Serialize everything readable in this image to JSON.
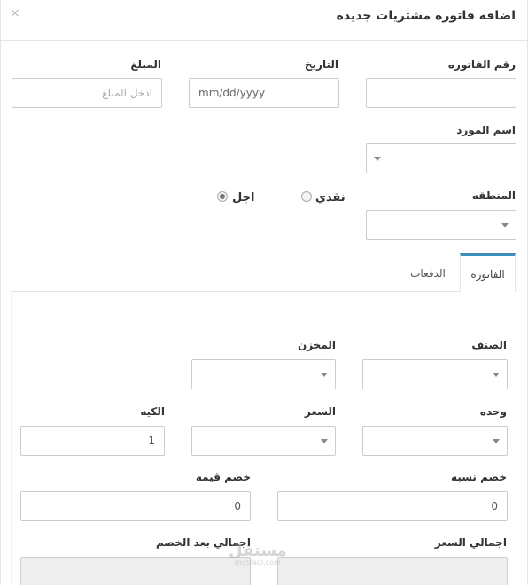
{
  "modal": {
    "title": "اضافه فاتوره مشتريات جديده",
    "close_glyph": "×"
  },
  "form": {
    "invoice_number": {
      "label": "رقم الفاتوره",
      "value": ""
    },
    "date": {
      "label": "التاريخ",
      "placeholder": "mm/dd/yyyy"
    },
    "amount": {
      "label": "المبلغ",
      "placeholder": "ادخل المبلغ"
    },
    "supplier": {
      "label": "اسم المورد",
      "value": ""
    },
    "region": {
      "label": "المنطقه",
      "value": ""
    },
    "payment_type": {
      "options": [
        {
          "label": "نقدي",
          "checked": false
        },
        {
          "label": "اجل",
          "checked": true
        }
      ]
    }
  },
  "tabs": [
    {
      "label": "الفاتوره",
      "active": true
    },
    {
      "label": "الدفعات",
      "active": false
    }
  ],
  "invoice_tab": {
    "item": {
      "label": "الصنف"
    },
    "warehouse": {
      "label": "المخزن"
    },
    "unit": {
      "label": "وحده"
    },
    "price": {
      "label": "السعر"
    },
    "quantity": {
      "label": "الكيه",
      "value": "1"
    },
    "discount_percent": {
      "label": "خصم نسبه",
      "value": "0"
    },
    "discount_value": {
      "label": "خصم قيمه",
      "value": "0"
    },
    "total_price": {
      "label": "اجمالي السعر"
    },
    "total_after_discount": {
      "label": "اجمالي بعد الخصم"
    }
  },
  "watermark": {
    "text": "مستقل",
    "subtext": "mostaql.com"
  }
}
